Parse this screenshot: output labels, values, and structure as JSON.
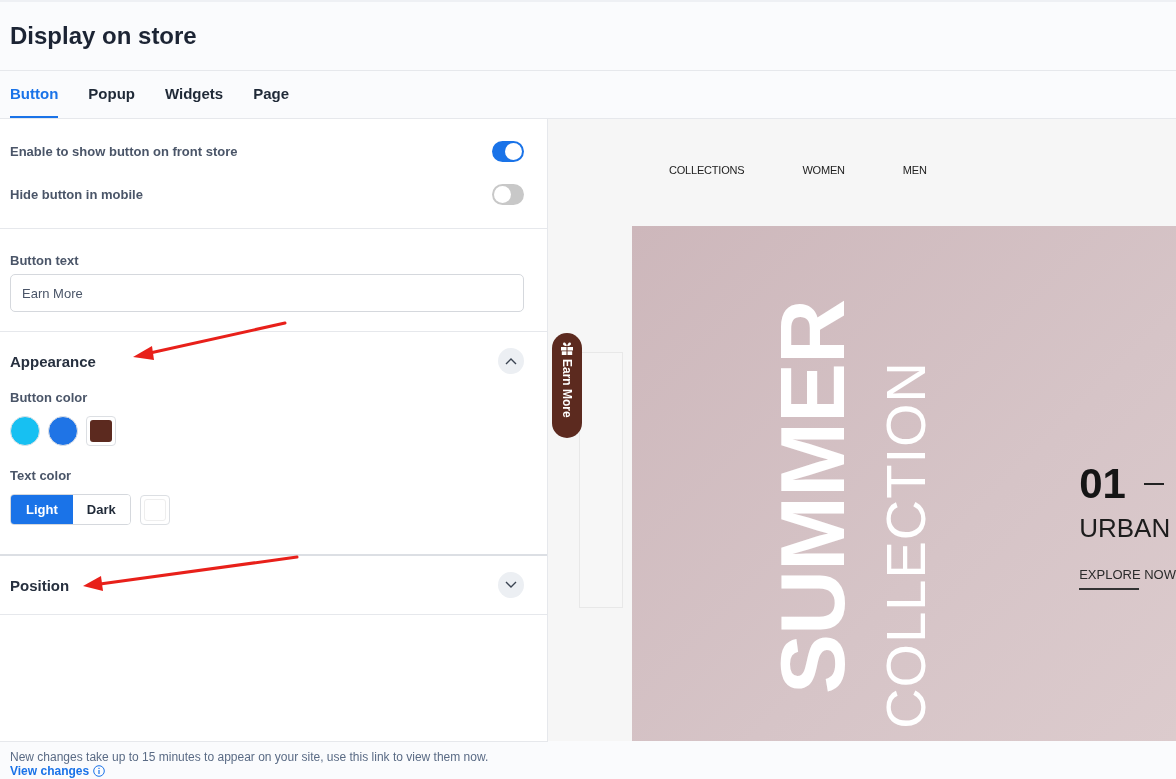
{
  "title": "Display on store",
  "tabs": [
    {
      "label": "Button",
      "selected": true
    },
    {
      "label": "Popup",
      "selected": false
    },
    {
      "label": "Widgets",
      "selected": false
    },
    {
      "label": "Page",
      "selected": false
    }
  ],
  "toggles": [
    {
      "label": "Enable to show button on front store",
      "on": true
    },
    {
      "label": "Hide button in mobile",
      "on": false
    }
  ],
  "button_text": {
    "label": "Button text",
    "value": "Earn More"
  },
  "sections": [
    {
      "title": "Appearance",
      "expanded": true,
      "button_color": {
        "label": "Button color",
        "swatches": [
          {
            "color": "#17c0f2",
            "selected": false
          },
          {
            "color": "#1f74e6",
            "selected": false
          },
          {
            "color": "#5c2a1f",
            "selected": true
          }
        ]
      },
      "text_color": {
        "label": "Text color",
        "options": [
          {
            "label": "Light",
            "selected": true
          },
          {
            "label": "Dark",
            "selected": false
          }
        ],
        "custom_swatch": {
          "color": "#ffffff"
        }
      }
    },
    {
      "title": "Position",
      "expanded": false
    }
  ],
  "preview": {
    "nav": [
      "COLLECTIONS",
      "WOMEN",
      "MEN"
    ],
    "floating_button": "Earn More",
    "hero": {
      "headline": "SUMMER",
      "subheadline": "COLLECTION",
      "number": "01",
      "title": "URBAN",
      "link": "EXPLORE NOW"
    }
  },
  "footer": {
    "text": "New changes take up to 15 minutes to appear on your site, use this link to view them now.",
    "link": "View changes"
  }
}
